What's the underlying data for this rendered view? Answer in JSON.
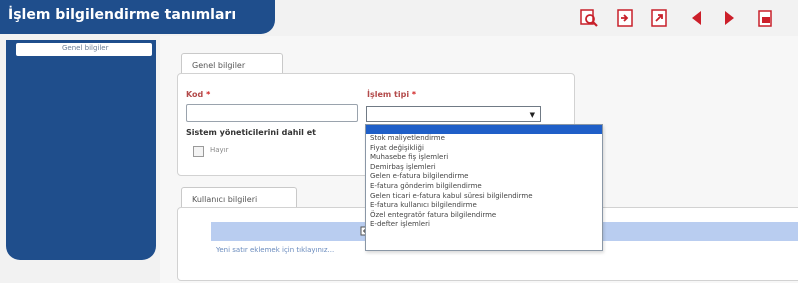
{
  "window": {
    "title": "İşlem bilgilendirme tanımları"
  },
  "toolbar": {
    "icons": [
      "search-detail-icon",
      "import-icon",
      "export-icon",
      "previous-icon",
      "next-icon",
      "print-icon"
    ]
  },
  "sidebar": {
    "items": [
      {
        "label": "Genel bilgiler"
      }
    ]
  },
  "general_tab": {
    "label": "Genel bilgiler",
    "kod_label": "Kod",
    "kod_value": "",
    "required_mark": "*",
    "islem_tipi_label": "İşlem tipi",
    "islem_tipi_value": "",
    "admin_label": "Sistem yöneticilerini dahil et",
    "admin_checkbox_label": "Hayır"
  },
  "dropdown": {
    "options": [
      "Stok maliyetlendirme",
      "Fiyat değişikliği",
      "Muhasebe fiş işlemleri",
      "Demirbaş işlemleri",
      "Gelen e-fatura bilgilendirme",
      "E-fatura gönderim bilgilendirme",
      "Gelen ticari e-fatura kabul süresi bilgilendirme",
      "E-fatura kullanıcı bilgilendirme",
      "Özel entegratör fatura bilgilendirme",
      "E-defter işlemleri"
    ]
  },
  "users_tab": {
    "label": "Kullanıcı bilgileri",
    "add_row_link": "Yeni satır eklemek için tıklayınız..."
  },
  "colors": {
    "brand": "#1f4e8c",
    "accent_red": "#cc1f2a",
    "selection": "#1f5fc8"
  }
}
